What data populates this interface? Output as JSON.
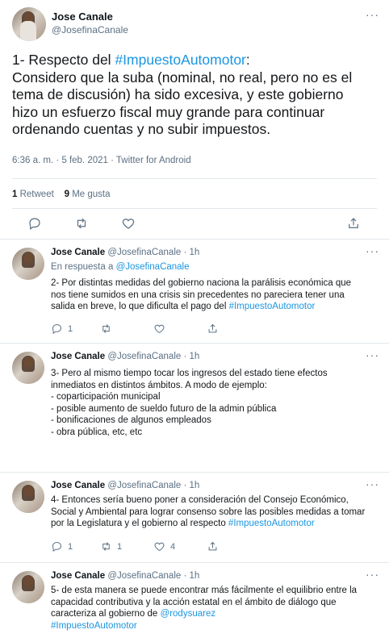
{
  "main_tweet": {
    "name": "Jose Canale",
    "handle": "@JosefinaCanale",
    "more": "···",
    "text_lines": [
      {
        "prefix": "1- Respecto del ",
        "hashtag": "#ImpuestoAutomotor",
        "suffix": ":"
      },
      {
        "text": "Considero que la suba (nominal, no real, pero no es el"
      },
      {
        "text": "tema de discusión) ha sido excesiva, y este gobierno"
      },
      {
        "text": "hizo un esfuerzo fiscal muy grande para continuar"
      },
      {
        "text": "ordenando cuentas y no subir impuestos."
      }
    ],
    "meta": "6:36 a. m. · 5 feb. 2021 · Twitter for Android",
    "retweets_count": "1",
    "retweets_label": "Retweet",
    "likes_count": "9",
    "likes_label": "Me gusta"
  },
  "replies": [
    {
      "name": "Jose Canale",
      "handle": "@JosefinaCanale",
      "time": "· 1h",
      "in_reply_prefix": "En respuesta a ",
      "in_reply_handle": "@JosefinaCanale",
      "lines": [
        "2- Por distintas medidas del gobierno naciona la parálisis económica que",
        "nos tiene sumidos en una crisis sin precedentes no pareciera tener una"
      ],
      "last_line_prefix": "salida en breve, lo que dificulta el pago del ",
      "last_line_hashtag": "#ImpuestoAutomotor",
      "replies_count": "1",
      "retweets_count": "",
      "likes_count": ""
    },
    {
      "name": "Jose Canale",
      "handle": "@JosefinaCanale",
      "time": "· 1h",
      "lines": [
        "3- Pero al mismo tiempo tocar los ingresos del estado tiene efectos",
        "inmediatos en distintos ámbitos. A modo de ejemplo:",
        "- coparticipación municipal",
        "- posible aumento de sueldo futuro de la admin pública",
        "- bonificaciones de algunos empleados",
        "- obra pública, etc, etc"
      ],
      "replies_count": "1",
      "retweets_count": "",
      "likes_count": ""
    },
    {
      "name": "Jose Canale",
      "handle": "@JosefinaCanale",
      "time": "· 1h",
      "lines": [
        "4- Entonces sería bueno poner a consideración del Consejo Económico,",
        "Social y Ambiental para lograr consenso sobre las posibles medidas a tomar"
      ],
      "last_line_prefix": "por la Legislatura y el gobierno al respecto ",
      "last_line_hashtag": "#ImpuestoAutomotor",
      "replies_count": "1",
      "retweets_count": "1",
      "likes_count": "4"
    },
    {
      "name": "Jose Canale",
      "handle": "@JosefinaCanale",
      "time": "· 1h",
      "lines": [
        "5- de esta manera se puede encontrar más fácilmente el equilibrio entre la",
        "capacidad contributiva y la acción estatal en el ámbito de diálogo que"
      ],
      "last_line_prefix": "caracteriza al gobierno de ",
      "last_line_mention": "@rodysuarez",
      "hashtag_line": "#ImpuestoAutomotor"
    }
  ],
  "icons": [
    "reply-icon",
    "retweet-icon",
    "like-icon",
    "share-icon",
    "more-icon"
  ],
  "colors": {
    "link": "#1b95e0",
    "muted": "#5b7083",
    "divider": "#e1e8ed"
  }
}
